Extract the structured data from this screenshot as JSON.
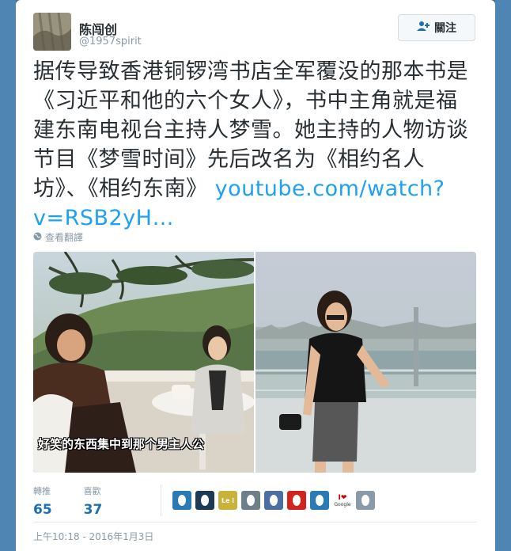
{
  "user": {
    "name": "陈闯创",
    "handle": "@1957spirit"
  },
  "follow_button": {
    "label": "關注"
  },
  "tweet": {
    "lines": [
      "据传导致香港铜锣湾书店全军覆没的那本书是",
      "《习近平和他的六个女人》，书中主角就是福",
      "建东南电视台主持人梦雪。她主持的人物访谈",
      "节目《梦雪时间》先后改名为《相约名人",
      "坊》、《相约东南》"
    ],
    "link_part1": "youtube.com/watch?",
    "link_part2": "v=RSB2yH…"
  },
  "translate_label": "查看翻譯",
  "media": {
    "caption": "好笑的东西集中到那个男主人公"
  },
  "stats": {
    "retweets": {
      "label": "轉推",
      "value": "65"
    },
    "likes": {
      "label": "喜歡",
      "value": "37"
    }
  },
  "likers": [
    {
      "color": "#2a7ab5"
    },
    {
      "color": "#1d3a55"
    },
    {
      "color": "#c8b23a",
      "text": "Le i"
    },
    {
      "color": "#6d7f8a"
    },
    {
      "color": "#4a6fa0"
    },
    {
      "color": "#d2241f"
    },
    {
      "color": "#2a7ab5"
    },
    {
      "color": "#ffffff",
      "text": "I❤",
      "subtext": "Google"
    },
    {
      "color": "#8a9aa8"
    }
  ],
  "timestamp": "上午10:18 - 2016年1月3日"
}
